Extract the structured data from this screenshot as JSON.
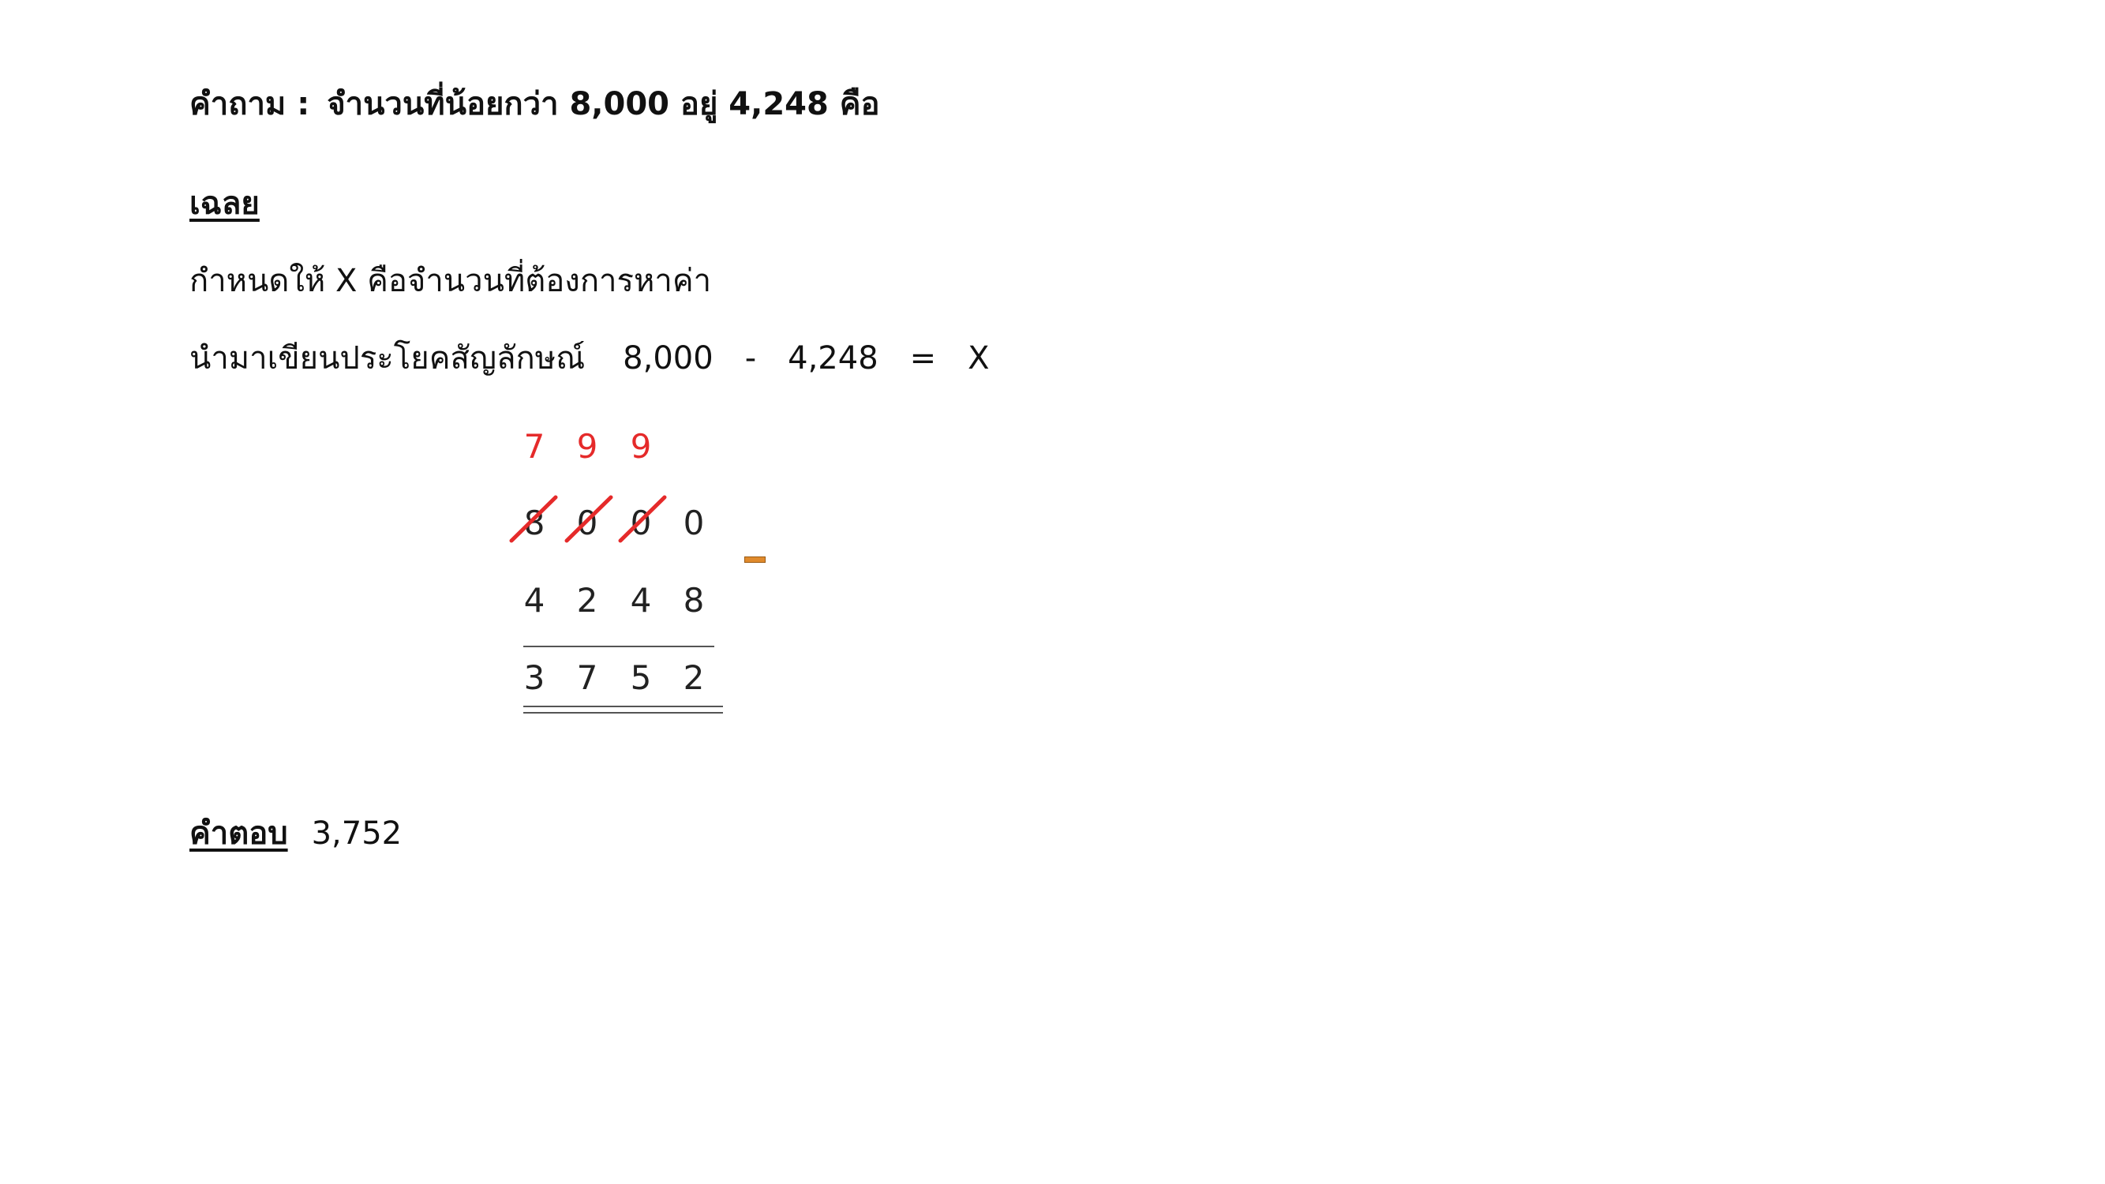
{
  "question": {
    "label": "คำถาม :",
    "text": "จำนวนที่น้อยกว่า 8,000 อยู่ 4,248 คือ"
  },
  "solution": {
    "heading": "เฉลย",
    "given": "กำหนดให้ X คือจำนวนที่ต้องการหาค่า",
    "equation_prefix": "นำมาเขียนประโยคสัญลักษณ์",
    "equation_parts": [
      "8,000",
      "-",
      "4,248",
      "=",
      "X"
    ]
  },
  "subtraction": {
    "borrow_row": [
      "7",
      "9",
      "9"
    ],
    "minuend": [
      "8",
      "0",
      "0",
      "0"
    ],
    "subtrahend": [
      "4",
      "2",
      "4",
      "8"
    ],
    "difference": [
      "3",
      "7",
      "5",
      "2"
    ],
    "crossed_out_count": 3,
    "accent_colors": {
      "borrow": "#e52a2a",
      "strike": "#e52a2a",
      "minus_sign": "#e08a2c"
    }
  },
  "answer": {
    "label": "คำตอบ",
    "value": "3,752"
  }
}
